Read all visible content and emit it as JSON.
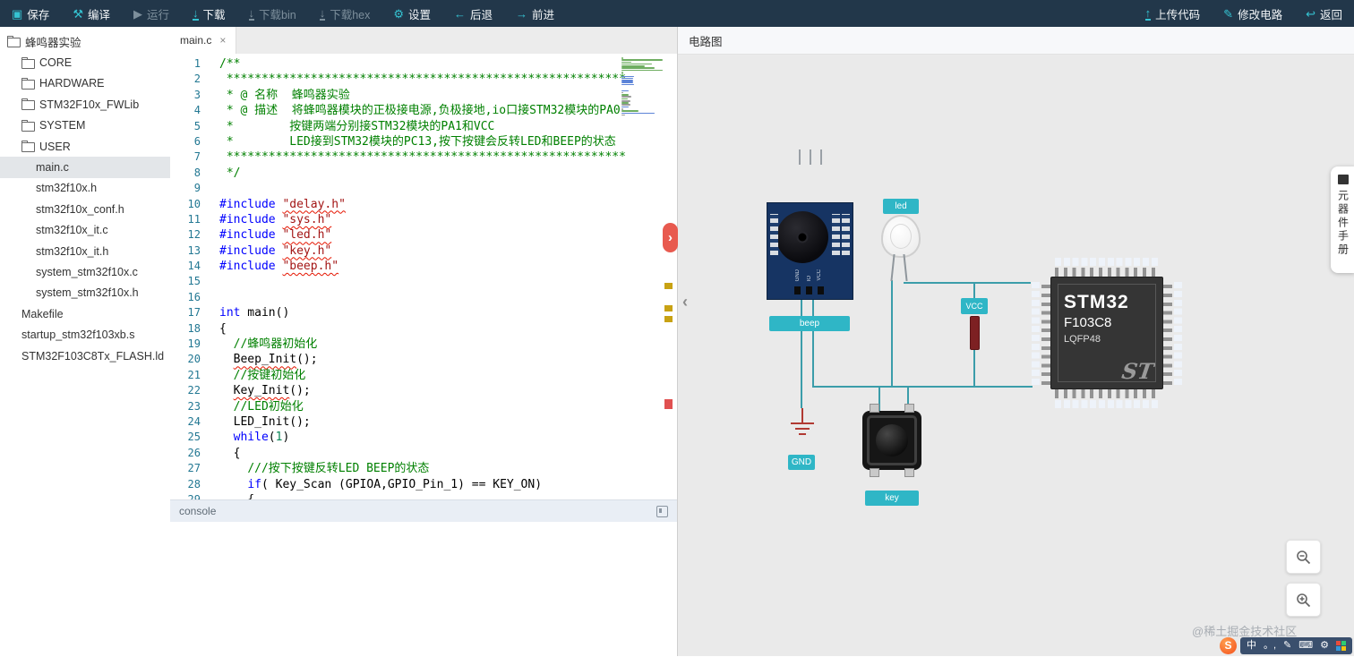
{
  "icons": {
    "chevron_right": "›",
    "chevron_left": "‹"
  },
  "toolbar": {
    "left": [
      {
        "name": "save",
        "label": "保存",
        "glyph": "▣",
        "enabled": true
      },
      {
        "name": "compile",
        "label": "编译",
        "glyph": "⚒",
        "enabled": true
      },
      {
        "name": "run",
        "label": "运行",
        "glyph": "▶",
        "enabled": false
      },
      {
        "name": "download",
        "label": "下载",
        "glyph": "↓",
        "bar": true,
        "enabled": true
      },
      {
        "name": "download-bin",
        "label": "下载bin",
        "glyph": "↓",
        "bar": true,
        "enabled": false
      },
      {
        "name": "download-hex",
        "label": "下载hex",
        "glyph": "↓",
        "bar": true,
        "enabled": false
      },
      {
        "name": "settings",
        "label": "设置",
        "glyph": "⚙",
        "enabled": true
      },
      {
        "name": "back",
        "label": "后退",
        "glyph": "←",
        "enabled": true
      },
      {
        "name": "forward",
        "label": "前进",
        "glyph": "→",
        "enabled": true
      }
    ],
    "right": [
      {
        "name": "upload-code",
        "label": "上传代码",
        "glyph": "↑",
        "bar": true,
        "enabled": true
      },
      {
        "name": "edit-circuit",
        "label": "修改电路",
        "glyph": "✎",
        "enabled": true
      },
      {
        "name": "return",
        "label": "返回",
        "glyph": "↩",
        "enabled": true
      }
    ]
  },
  "sidebar": {
    "items": [
      {
        "label": "蜂鸣器实验",
        "type": "folder-open",
        "level": 0
      },
      {
        "label": "CORE",
        "type": "folder",
        "level": 1
      },
      {
        "label": "HARDWARE",
        "type": "folder",
        "level": 1
      },
      {
        "label": "STM32F10x_FWLib",
        "type": "folder",
        "level": 1
      },
      {
        "label": "SYSTEM",
        "type": "folder",
        "level": 1
      },
      {
        "label": "USER",
        "type": "folder",
        "level": 1
      },
      {
        "label": "main.c",
        "type": "file",
        "level": 2,
        "selected": true
      },
      {
        "label": "stm32f10x.h",
        "type": "file",
        "level": 2
      },
      {
        "label": "stm32f10x_conf.h",
        "type": "file",
        "level": 2
      },
      {
        "label": "stm32f10x_it.c",
        "type": "file",
        "level": 2
      },
      {
        "label": "stm32f10x_it.h",
        "type": "file",
        "level": 2
      },
      {
        "label": "system_stm32f10x.c",
        "type": "file",
        "level": 2
      },
      {
        "label": "system_stm32f10x.h",
        "type": "file",
        "level": 2
      },
      {
        "label": "Makefile",
        "type": "file",
        "level": 1
      },
      {
        "label": "startup_stm32f103xb.s",
        "type": "file",
        "level": 1
      },
      {
        "label": "STM32F103C8Tx_FLASH.ld",
        "type": "file",
        "level": 1
      }
    ]
  },
  "editor": {
    "tab": "main.c",
    "tab_close": "×",
    "lines": [
      {
        "n": 1,
        "seg": [
          [
            "c",
            "/**"
          ]
        ]
      },
      {
        "n": 2,
        "seg": [
          [
            "c",
            " *********************************************************"
          ]
        ]
      },
      {
        "n": 3,
        "seg": [
          [
            "c",
            " * @ 名称  蜂鸣器实验"
          ]
        ]
      },
      {
        "n": 4,
        "seg": [
          [
            "c",
            " * @ 描述  将蜂鸣器模块的正极接电源,负极接地,io口接STM32模块的PA0"
          ]
        ]
      },
      {
        "n": 5,
        "seg": [
          [
            "c",
            " *        按键两端分别接STM32模块的PA1和VCC"
          ]
        ]
      },
      {
        "n": 6,
        "seg": [
          [
            "c",
            " *        LED接到STM32模块的PC13,按下按键会反转LED和BEEP的状态"
          ]
        ]
      },
      {
        "n": 7,
        "seg": [
          [
            "c",
            " *********************************************************"
          ]
        ]
      },
      {
        "n": 8,
        "seg": [
          [
            "c",
            " */"
          ]
        ]
      },
      {
        "n": 9,
        "seg": []
      },
      {
        "n": 10,
        "seg": [
          [
            "k",
            "#include "
          ],
          [
            "se",
            "\"delay.h\""
          ]
        ]
      },
      {
        "n": 11,
        "seg": [
          [
            "k",
            "#include "
          ],
          [
            "se",
            "\"sys.h\""
          ]
        ]
      },
      {
        "n": 12,
        "seg": [
          [
            "k",
            "#include "
          ],
          [
            "se",
            "\"led.h\""
          ]
        ]
      },
      {
        "n": 13,
        "seg": [
          [
            "k",
            "#include "
          ],
          [
            "se",
            "\"key.h\""
          ]
        ]
      },
      {
        "n": 14,
        "seg": [
          [
            "k",
            "#include "
          ],
          [
            "se",
            "\"beep.h\""
          ]
        ]
      },
      {
        "n": 15,
        "seg": []
      },
      {
        "n": 16,
        "seg": []
      },
      {
        "n": 17,
        "seg": [
          [
            "k",
            "int"
          ],
          [
            "p",
            " main()"
          ]
        ]
      },
      {
        "n": 18,
        "seg": [
          [
            "p",
            "{"
          ]
        ]
      },
      {
        "n": 19,
        "seg": [
          [
            "p",
            "  "
          ],
          [
            "c",
            "//蜂鸣器初始化"
          ]
        ]
      },
      {
        "n": 20,
        "seg": [
          [
            "p",
            "  "
          ],
          [
            "pe",
            "Beep_Init"
          ],
          [
            "p",
            "();"
          ]
        ]
      },
      {
        "n": 21,
        "seg": [
          [
            "p",
            "  "
          ],
          [
            "c",
            "//按键初始化"
          ]
        ]
      },
      {
        "n": 22,
        "seg": [
          [
            "p",
            "  "
          ],
          [
            "pe",
            "Key_Init"
          ],
          [
            "p",
            "();"
          ]
        ]
      },
      {
        "n": 23,
        "seg": [
          [
            "p",
            "  "
          ],
          [
            "c",
            "//LED初始化"
          ]
        ]
      },
      {
        "n": 24,
        "seg": [
          [
            "p",
            "  LED_Init();"
          ]
        ]
      },
      {
        "n": 25,
        "seg": [
          [
            "p",
            "  "
          ],
          [
            "k",
            "while"
          ],
          [
            "p",
            "("
          ],
          [
            "n2",
            "1"
          ],
          [
            "p",
            ")"
          ]
        ]
      },
      {
        "n": 26,
        "seg": [
          [
            "p",
            "  {"
          ]
        ]
      },
      {
        "n": 27,
        "seg": [
          [
            "p",
            "    "
          ],
          [
            "c",
            "///按下按键反转LED BEEP的状态"
          ]
        ]
      },
      {
        "n": 28,
        "seg": [
          [
            "p",
            "    "
          ],
          [
            "k",
            "if"
          ],
          [
            "p",
            "( Key_Scan (GPIOA,GPIO_Pin_1) == KEY_ON)"
          ]
        ]
      },
      {
        "n": 29,
        "seg": [
          [
            "p",
            "    {"
          ]
        ]
      }
    ]
  },
  "console": {
    "title": "console"
  },
  "circuit": {
    "header": "电路图",
    "labels": {
      "buzzer": "beep",
      "led": "led",
      "key": "key",
      "vcc": "VCC",
      "gnd": "GND"
    },
    "buzzer_pins": [
      "GND",
      "IO",
      "VCC"
    ],
    "chip": {
      "line1": "STM32",
      "line2": "F103C8",
      "line3": "LQFP48",
      "logo": "ST"
    },
    "manual_button": "元器件手册",
    "watermark": "@稀土掘金技术社区"
  },
  "ime": {
    "logo": "S",
    "lang": "中",
    "punct": "。,",
    "pen": "✎",
    "kbd": "⌨",
    "tool": "⚙"
  }
}
